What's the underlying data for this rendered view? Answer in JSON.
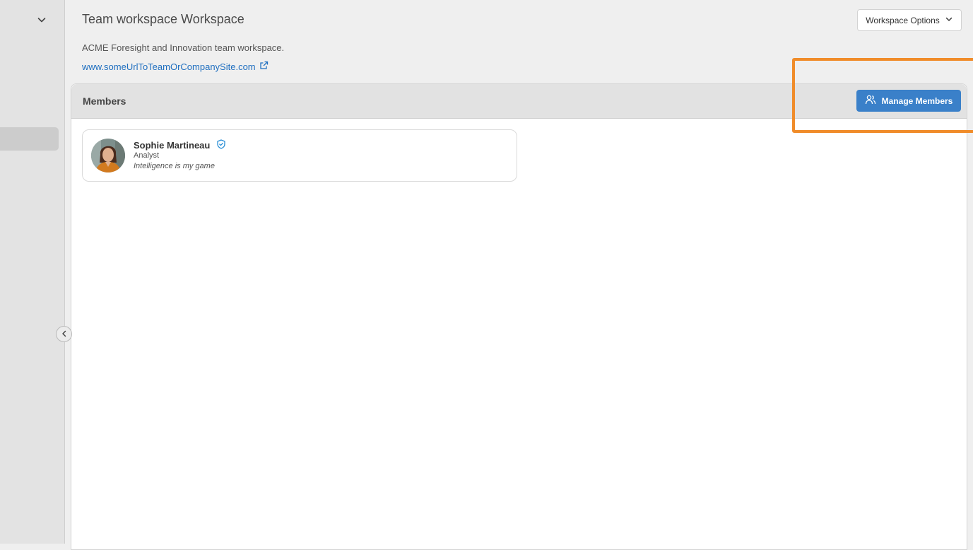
{
  "colors": {
    "accent": "#3a80c9",
    "link": "#1f6fc0",
    "highlight": "#f08c2a",
    "verified": "#2b8fd6"
  },
  "sidebar": {
    "expand_icon": "chevron-down-icon",
    "collapse_icon": "chevron-left-icon"
  },
  "workspace": {
    "title": "Team workspace Workspace",
    "options_label": "Workspace Options",
    "description": "ACME Foresight and Innovation team workspace.",
    "link": "www.someUrlToTeamOrCompanySite.com"
  },
  "members": {
    "title": "Members",
    "manage_label": "Manage Members",
    "list": [
      {
        "name": "Sophie Martineau",
        "role": "Analyst",
        "bio": "Intelligence is my game",
        "badge_icon": "verified-shield-icon"
      }
    ]
  }
}
